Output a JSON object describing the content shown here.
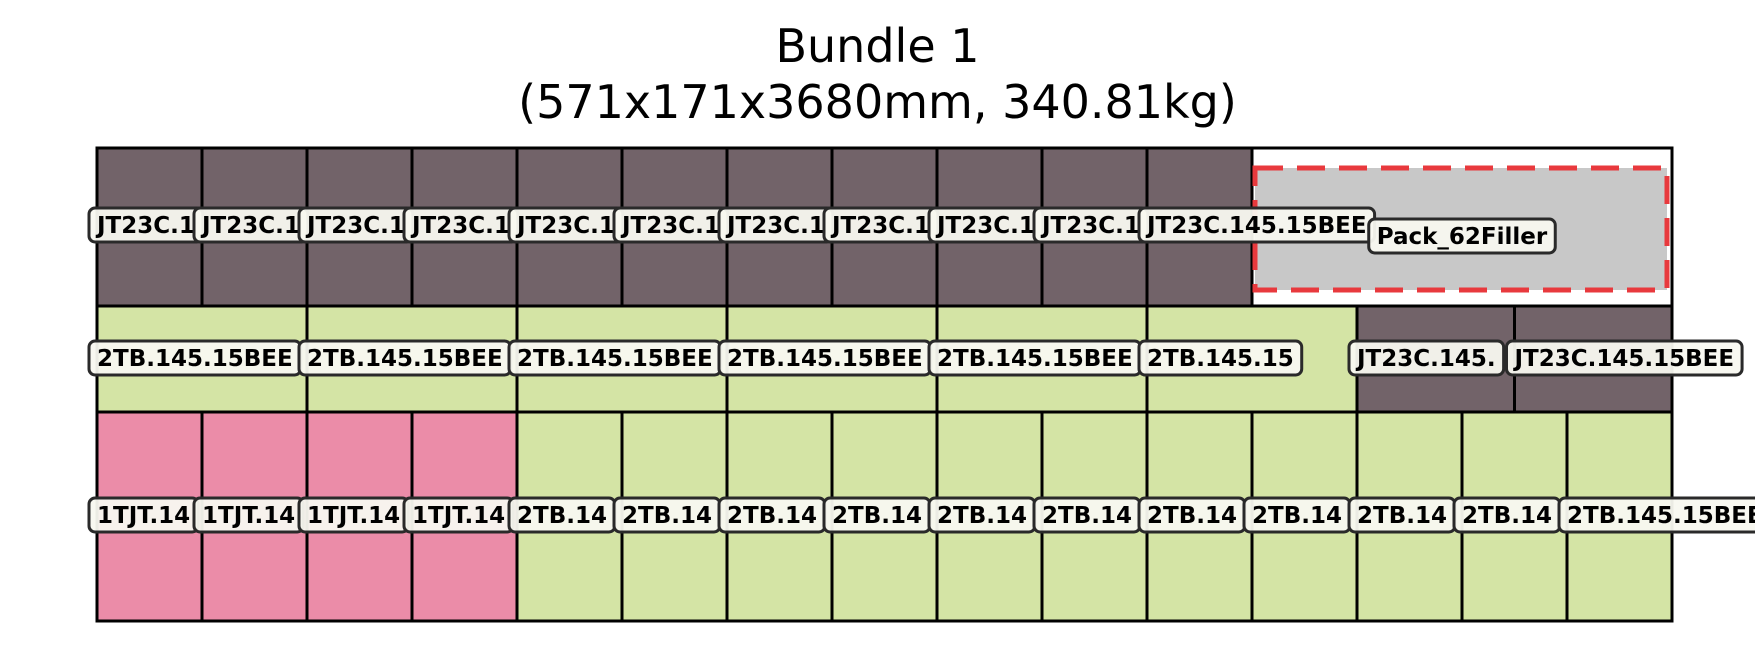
{
  "title": "Bundle 1",
  "subtitle": "(571x171x3680mm, 340.81kg)",
  "colors": {
    "dark": "#726369",
    "green": "#d4e4a5",
    "pink": "#eb8ca8",
    "filler": "#c8c8c8",
    "filler_border": "#e8393d",
    "outline": "#000000",
    "label_bg": "#f8f8f0",
    "label_border": "#2a2a2a"
  },
  "layers": [
    {
      "name": "top",
      "label_row": 0,
      "groups": [
        {
          "product": "JT23C.145.15BEE",
          "count": 11,
          "color": "dark",
          "labels": [
            "JT23C.1",
            "JT23C.1",
            "JT23C.1",
            "JT23C.1",
            "JT23C.1",
            "JT23C.1",
            "JT23C.1",
            "JT23C.1",
            "JT23C.1",
            "JT23C.1",
            "JT23C.145.15BEE"
          ]
        }
      ],
      "filler": {
        "label": "Pack_62Filler"
      }
    },
    {
      "name": "middle",
      "groups": [
        {
          "product": "2TB.145.15BEE",
          "count": 6,
          "color": "green",
          "labels": [
            "2TB.145.15BEE",
            "2TB.145.15BEE",
            "2TB.145.15BEE",
            "2TB.145.15BEE",
            "2TB.145.15BEE",
            "2TB.145.15"
          ]
        },
        {
          "product": "JT23C.145.15BEE",
          "count": 2,
          "color": "dark",
          "labels": [
            "JT23C.145.",
            "JT23C.145.15BEE"
          ]
        }
      ]
    },
    {
      "name": "bottom",
      "groups": [
        {
          "product": "1TJT.14",
          "count": 4,
          "color": "pink",
          "labels": [
            "1TJT.14",
            "1TJT.14",
            "1TJT.14",
            "1TJT.14"
          ]
        },
        {
          "product": "2TB.145.15BEE",
          "count": 11,
          "color": "green",
          "labels": [
            "2TB.14",
            "2TB.14",
            "2TB.14",
            "2TB.14",
            "2TB.14",
            "2TB.14",
            "2TB.14",
            "2TB.14",
            "2TB.14",
            "2TB.14",
            "2TB.145.15BEE"
          ]
        }
      ]
    }
  ]
}
